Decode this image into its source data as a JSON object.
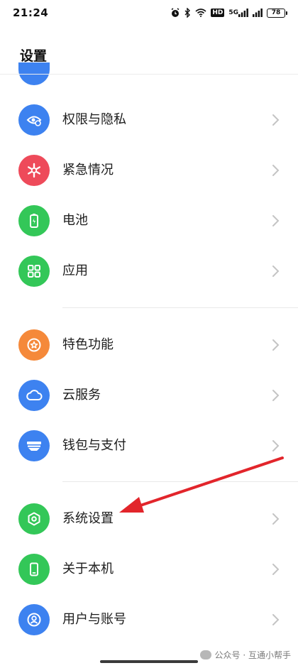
{
  "status_bar": {
    "time": "21:24",
    "hd": "HD",
    "signal_label": "5G",
    "battery": "78"
  },
  "page_title": "设置",
  "colors": {
    "blue": "#3d82f0",
    "red": "#ee4a5a",
    "green": "#33c758",
    "orange": "#f5893a",
    "arrow": "#e2252b"
  },
  "rows": [
    {
      "label": "权限与隐私",
      "icon": "eye-shield-icon",
      "color": "blue"
    },
    {
      "label": "紧急情况",
      "icon": "asterisk-icon",
      "color": "red"
    },
    {
      "label": "电池",
      "icon": "battery-icon",
      "color": "green"
    },
    {
      "label": "应用",
      "icon": "grid-icon",
      "color": "green"
    },
    {
      "label": "特色功能",
      "icon": "star-icon",
      "color": "orange"
    },
    {
      "label": "云服务",
      "icon": "cloud-icon",
      "color": "blue"
    },
    {
      "label": "钱包与支付",
      "icon": "wallet-icon",
      "color": "blue"
    },
    {
      "label": "系统设置",
      "icon": "hexagon-gear-icon",
      "color": "green"
    },
    {
      "label": "关于本机",
      "icon": "phone-icon",
      "color": "green"
    },
    {
      "label": "用户与账号",
      "icon": "user-icon",
      "color": "blue"
    }
  ],
  "watermark": "公众号 · 互通小帮手"
}
